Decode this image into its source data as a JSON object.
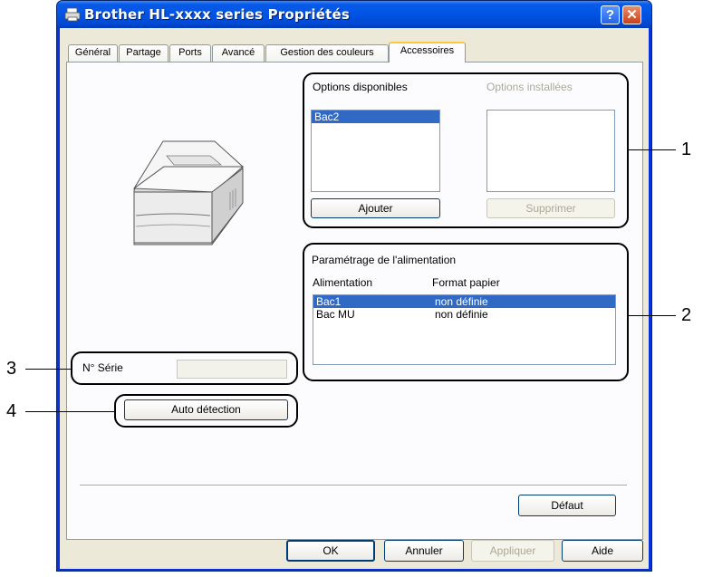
{
  "window": {
    "title": "Brother HL-xxxx series Propriétés",
    "help_glyph": "?",
    "close_glyph": "✕"
  },
  "tabs": [
    {
      "label": "Général"
    },
    {
      "label": "Partage"
    },
    {
      "label": "Ports"
    },
    {
      "label": "Avancé"
    },
    {
      "label": "Gestion des couleurs"
    },
    {
      "label": "Accessoires",
      "active": true
    }
  ],
  "options": {
    "available_label": "Options disponibles",
    "installed_label": "Options installées",
    "available_items": [
      "Bac2"
    ],
    "add_button": "Ajouter",
    "remove_button": "Supprimer"
  },
  "paper_source": {
    "group_label": "Paramétrage de l'alimentation",
    "col_source": "Alimentation",
    "col_format": "Format papier",
    "rows": [
      {
        "source": "Bac1",
        "format": "non définie"
      },
      {
        "source": "Bac MU",
        "format": "non définie"
      }
    ]
  },
  "serial": {
    "label": "N° Série",
    "value": ""
  },
  "auto_detect_button": "Auto détection",
  "default_button": "Défaut",
  "footer": {
    "ok": "OK",
    "cancel": "Annuler",
    "apply": "Appliquer",
    "help": "Aide"
  },
  "callouts": {
    "c1": "1",
    "c2": "2",
    "c3": "3",
    "c4": "4"
  },
  "colors": {
    "title_bar": "#0054e3",
    "selection": "#316ac5",
    "active_tab_accent": "#ffc83c"
  }
}
